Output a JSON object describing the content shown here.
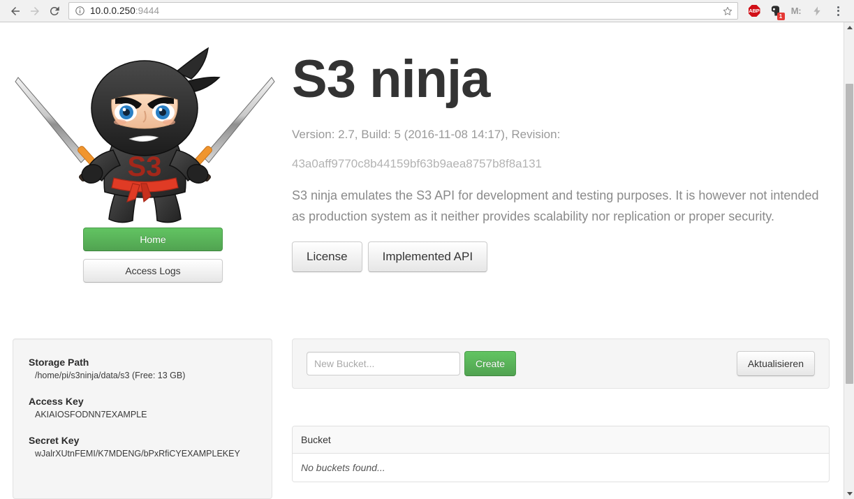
{
  "browser": {
    "back_icon": "back-arrow-icon",
    "forward_icon": "forward-arrow-icon",
    "reload_icon": "reload-icon",
    "url_host": "10.0.0.250",
    "url_port": ":9444",
    "bookmark_icon": "star-icon",
    "extensions": [
      {
        "name": "adblock-plus",
        "label": "ABP"
      },
      {
        "name": "evernote-clipper",
        "label": "",
        "badge": "1"
      },
      {
        "name": "m-extension",
        "label": "M:"
      },
      {
        "name": "lightning-extension",
        "label": ""
      }
    ],
    "menu_icon": "three-dots-menu-icon"
  },
  "sidebar": {
    "mascot_alt": "s3-ninja-mascot",
    "mascot_chest_text": "S3",
    "buttons": [
      {
        "label": "Home",
        "style": "success",
        "name": "home-button"
      },
      {
        "label": "Access Logs",
        "style": "default",
        "name": "access-logs-button"
      }
    ]
  },
  "hero": {
    "title": "S3 ninja",
    "version": "Version: 2.7, Build: 5 (2016-11-08 14:17), Revision:",
    "revision": "43a0aff9770c8b44159bf63b9aea8757b8f8a131",
    "description": "S3 ninja emulates the S3 API for development and testing purposes. It is however not intended as production system as it neither provides scalability nor replication or proper security.",
    "actions": [
      {
        "label": "License",
        "name": "license-button"
      },
      {
        "label": "Implemented API",
        "name": "implemented-api-button"
      }
    ]
  },
  "info": {
    "storage_path_label": "Storage Path",
    "storage_path_value": "/home/pi/s3ninja/data/s3 (Free: 13 GB)",
    "access_key_label": "Access Key",
    "access_key_value": "AKIAIOSFODNN7EXAMPLE",
    "secret_key_label": "Secret Key",
    "secret_key_value": "wJalrXUtnFEMI/K7MDENG/bPxRfiCYEXAMPLEKEY"
  },
  "buckets": {
    "new_bucket_placeholder": "New Bucket...",
    "new_bucket_value": "",
    "create_label": "Create",
    "refresh_label": "Aktualisieren",
    "column_header": "Bucket",
    "empty_message": "No buckets found...",
    "rows": []
  },
  "colors": {
    "brand_green": "#5cb85c",
    "title_gray": "#333333",
    "muted_gray": "#999999",
    "panel_bg": "#f5f5f5",
    "badge_red": "#e53935"
  }
}
